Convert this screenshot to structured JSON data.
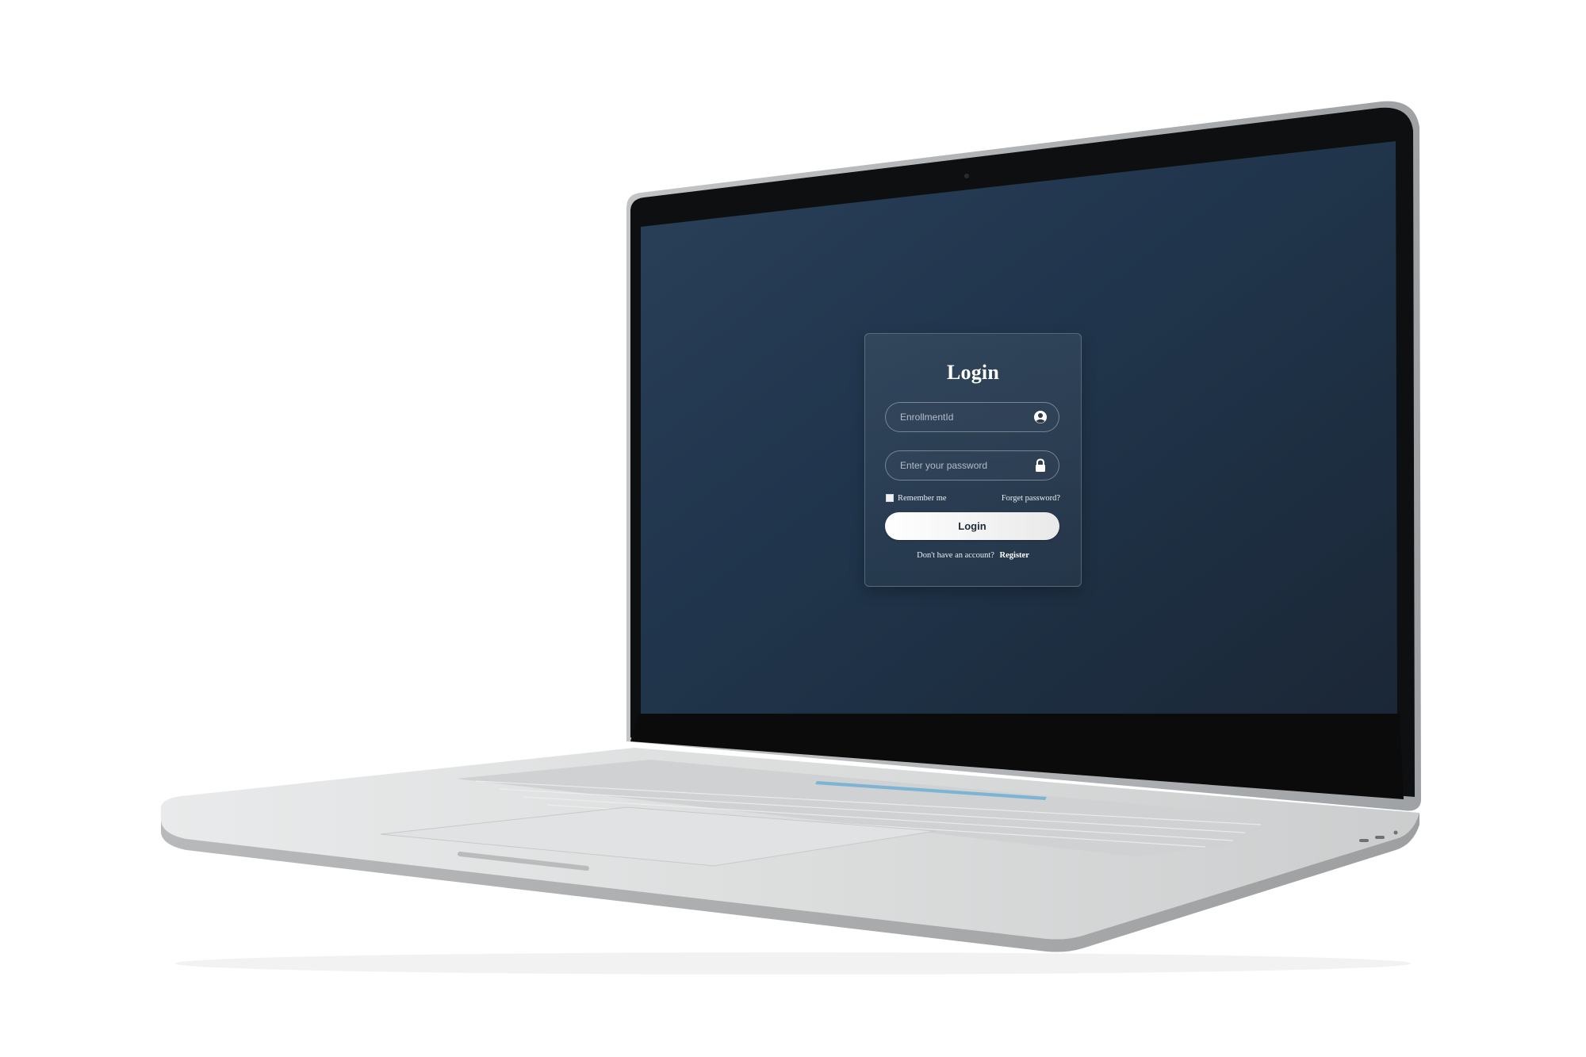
{
  "login_form": {
    "title": "Login",
    "enrollment_placeholder": "EnrollmentId",
    "password_placeholder": "Enter your password",
    "remember_label": "Remember me",
    "forgot_link": "Forget password?",
    "login_button": "Login",
    "register_prompt": "Don't have an account?",
    "register_link": "Register"
  },
  "icons": {
    "enrollment_field_icon": "user-circle-icon",
    "password_field_icon": "lock-icon"
  },
  "colors": {
    "screen_background_top": "#263a52",
    "screen_background_bottom": "#1a2a3b",
    "card_border": "#a7b2bd",
    "button_background": "#ffffff",
    "button_text": "#1f2a36",
    "laptop_silver": "#d9dbdc"
  }
}
